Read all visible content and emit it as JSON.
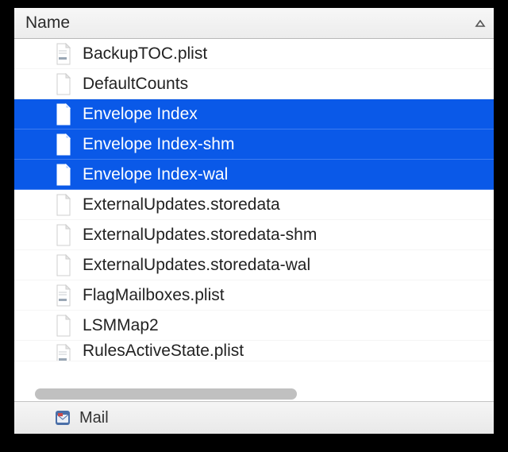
{
  "header": {
    "column_label": "Name",
    "sort_direction": "ascending"
  },
  "files": [
    {
      "name": "BackupTOC.plist",
      "icon": "plist",
      "selected": false
    },
    {
      "name": "DefaultCounts",
      "icon": "blank",
      "selected": false
    },
    {
      "name": "Envelope Index",
      "icon": "blank",
      "selected": true
    },
    {
      "name": "Envelope Index-shm",
      "icon": "blank",
      "selected": true
    },
    {
      "name": "Envelope Index-wal",
      "icon": "blank",
      "selected": true
    },
    {
      "name": "ExternalUpdates.storedata",
      "icon": "blank",
      "selected": false
    },
    {
      "name": "ExternalUpdates.storedata-shm",
      "icon": "blank",
      "selected": false
    },
    {
      "name": "ExternalUpdates.storedata-wal",
      "icon": "blank",
      "selected": false
    },
    {
      "name": "FlagMailboxes.plist",
      "icon": "plist",
      "selected": false
    },
    {
      "name": "LSMMap2",
      "icon": "blank",
      "selected": false
    },
    {
      "name": "RulesActiveState.plist",
      "icon": "plist",
      "selected": false,
      "partial": true
    }
  ],
  "footer": {
    "icon": "mail-app",
    "label": "Mail"
  },
  "colors": {
    "selection": "#0a59e8",
    "header_bg_top": "#f7f7f7",
    "header_bg_bottom": "#ececec"
  }
}
